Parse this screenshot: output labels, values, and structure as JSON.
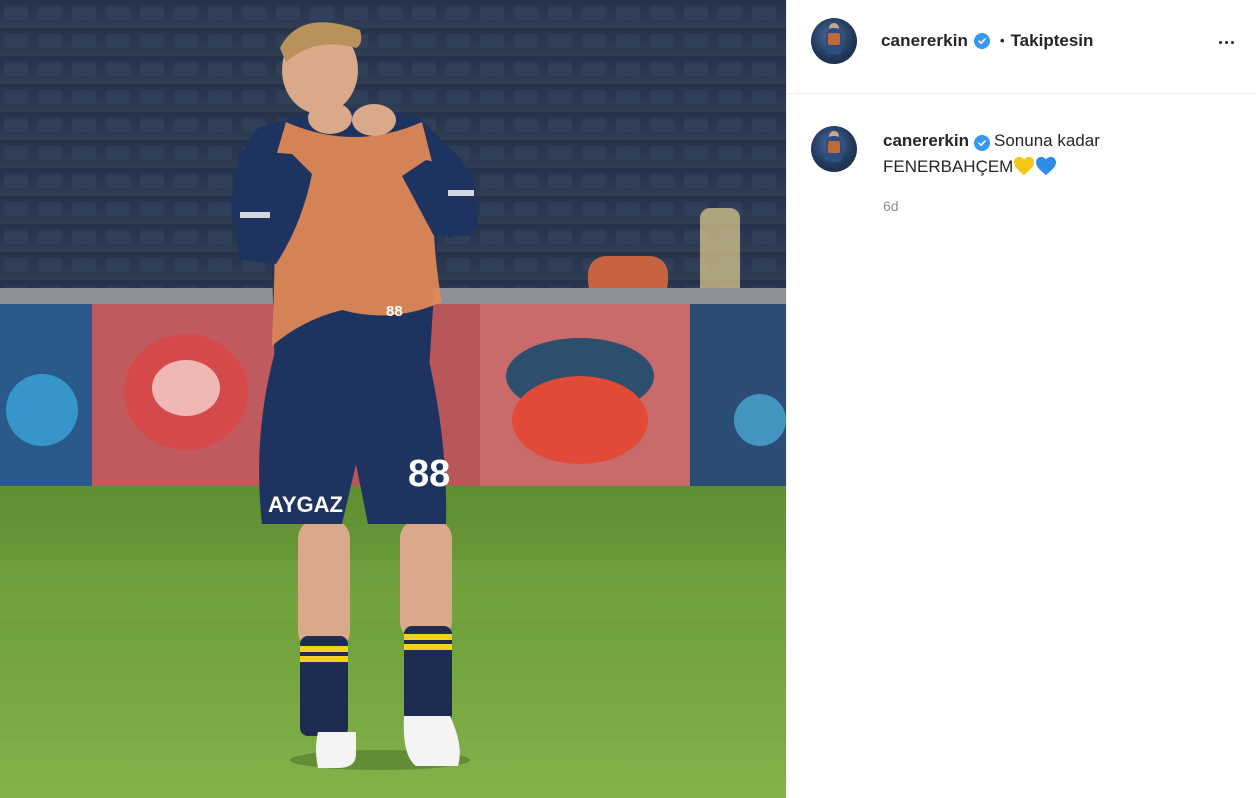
{
  "header": {
    "username": "canererkin",
    "separator": "•",
    "follow_status": "Takiptesin",
    "more_icon": "ellipsis-icon"
  },
  "caption": {
    "username": "canererkin",
    "text_line1": "Sonuna kadar",
    "text_line2": "FENERBAHÇEM",
    "emoji": [
      "yellow-heart",
      "blue-heart"
    ],
    "time": "6d"
  },
  "photo": {
    "shorts_brand": "AYGAZ",
    "shorts_number": "88",
    "shirt_number": "88"
  },
  "colors": {
    "verified": "#3897f0",
    "muted_text": "#8e8e8e",
    "kit_navy": "#1f3360",
    "vest_orange": "#e38a55",
    "pitch_green": "#6c9a3a",
    "heart_yellow": "#f5c518",
    "heart_blue": "#2e8be6"
  }
}
